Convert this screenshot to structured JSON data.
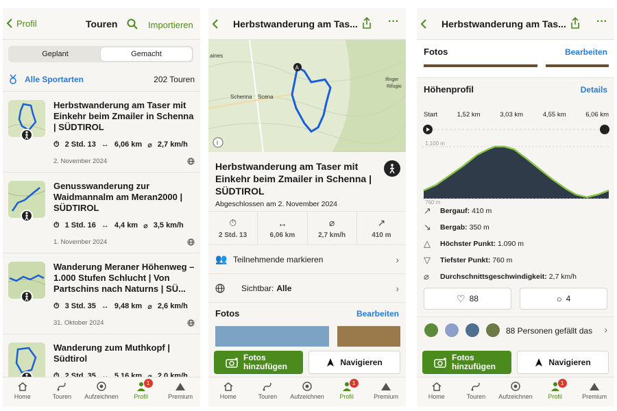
{
  "tabs": [
    "Home",
    "Touren",
    "Aufzeichnen",
    "Profil",
    "Premium"
  ],
  "profile_badge": "1",
  "screen1": {
    "back_label": "Profil",
    "title": "Touren",
    "import_label": "Importieren",
    "segments": [
      "Geplant",
      "Gemacht"
    ],
    "filter_label": "Alle Sportarten",
    "count": "202 Touren",
    "tours": [
      {
        "title": "Herbstwanderung am Taser mit Einkehr beim Zmailer in Schenna | SÜDTIROL",
        "duration": "2 Std. 13",
        "distance": "6,06 km",
        "speed": "2,7 km/h",
        "date": "2. November 2024"
      },
      {
        "title": "Genusswanderung zur Waidmannalm am Meran2000 | SÜDTIROL",
        "duration": "1 Std. 16",
        "distance": "4,4 km",
        "speed": "3,5 km/h",
        "date": "1. November 2024"
      },
      {
        "title": "Wanderung Meraner Höhenweg – 1.000 Stufen Schlucht | Von Partschins nach Naturns | SÜ...",
        "duration": "3 Std. 35",
        "distance": "9,48 km",
        "speed": "2,6 km/h",
        "date": "31. Oktober 2024"
      },
      {
        "title": "Wanderung zum Muthkopf | Südtirol",
        "duration": "2 Std. 35",
        "distance": "5,16 km",
        "speed": "2,0 km/h",
        "date": ""
      }
    ]
  },
  "screen2": {
    "title": "Herbstwanderung am Tas...",
    "map_labels": {
      "place1": "Schenna",
      "place2": "Scena",
      "place3": "aines",
      "place4": "Ifinger",
      "place5": "Rifugio",
      "start_marker": "A"
    },
    "tour_title": "Herbstwanderung am Taser mit Einkehr beim Zmailer in Schenna | SÜDTIROL",
    "completed": "Abgeschlossen am 2. November 2024",
    "stats": [
      {
        "icon": "stopwatch-icon",
        "value": "2 Std. 13"
      },
      {
        "icon": "distance-icon",
        "value": "6,06 km"
      },
      {
        "icon": "speed-icon",
        "value": "2,7 km/h"
      },
      {
        "icon": "ascent-icon",
        "value": "410 m"
      }
    ],
    "participants": "Teilnehmende markieren",
    "visible_label": "Sichtbar:",
    "visible_value": "Alle",
    "photos": "Fotos",
    "edit": "Bearbeiten",
    "add_photos": "Fotos hinzufügen",
    "navigate": "Navigieren"
  },
  "screen3": {
    "title": "Herbstwanderung am Tas...",
    "photos": "Fotos",
    "edit": "Bearbeiten",
    "profile_title": "Höhenprofil",
    "details": "Details",
    "dist_labels": [
      "Start",
      "1,52 km",
      "3,03 km",
      "4,55 km",
      "6,06 km"
    ],
    "max_label": "1.100 m",
    "min_label": "760 m",
    "rows": [
      {
        "icon": "ascent-icon",
        "label": "Bergauf:",
        "value": "410 m"
      },
      {
        "icon": "descent-icon",
        "label": "Bergab:",
        "value": "350 m"
      },
      {
        "icon": "highest-point-icon",
        "label": "Höchster Punkt:",
        "value": "1.090 m"
      },
      {
        "icon": "lowest-point-icon",
        "label": "Tiefster Punkt:",
        "value": "760 m"
      },
      {
        "icon": "avg-speed-icon",
        "label": "Durchschnittsgeschwindigkeit:",
        "value": "2,7 km/h"
      }
    ],
    "likes": "88",
    "comments": "4",
    "likes_text": "88 Personen gefällt das",
    "add_photos": "Fotos hinzufügen",
    "navigate": "Navigieren"
  },
  "colors": {
    "accent": "#4b8b1e",
    "link": "#2a7bd6",
    "route": "#1a5fd6"
  }
}
